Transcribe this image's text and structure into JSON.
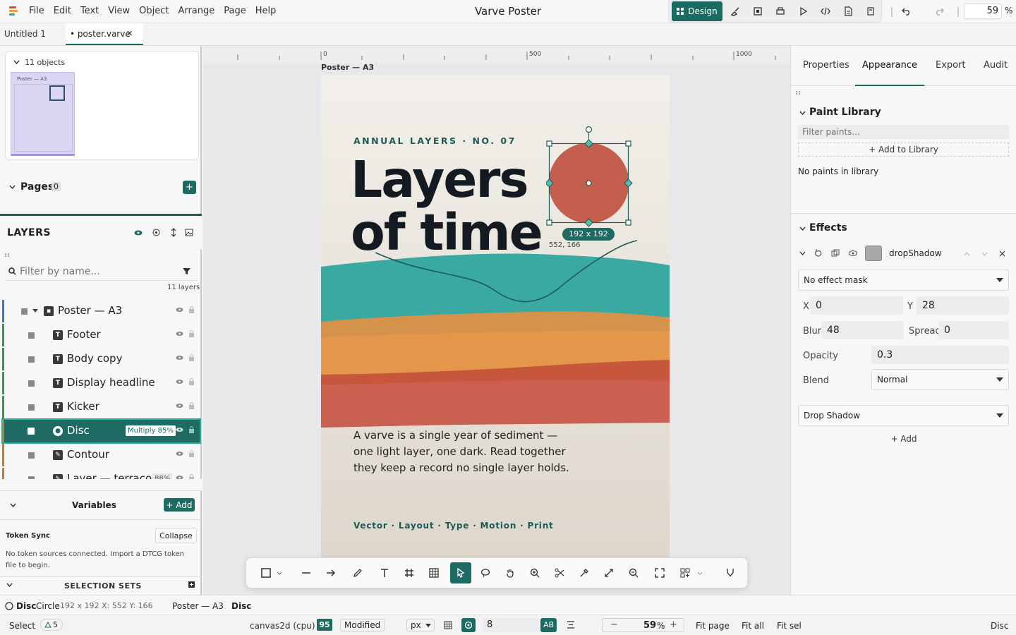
{
  "app": {
    "title": "Varve Poster",
    "menu": [
      "File",
      "Edit",
      "Text",
      "View",
      "Object",
      "Arrange",
      "Page",
      "Help"
    ],
    "design_label": "Design",
    "zoom": "59",
    "zoom_unit": "%"
  },
  "tabs": [
    {
      "label": "Untitled 1"
    },
    {
      "label": "• poster.varve",
      "close": "✕"
    }
  ],
  "overview": {
    "count": "11 objects",
    "thumb_label": "Poster — A3"
  },
  "pages": {
    "label": "Pages",
    "count": "0",
    "add": "+"
  },
  "layers": {
    "title": "LAYERS",
    "filter_placeholder": "Filter by name...",
    "count": "11 layers",
    "items": [
      {
        "name": "Poster — A3",
        "type": "frame",
        "color": "#3b73c9"
      },
      {
        "name": "Footer",
        "type": "text",
        "color": "#2c9a4a"
      },
      {
        "name": "Body copy",
        "type": "text",
        "color": "#2c9a4a"
      },
      {
        "name": "Display headline",
        "type": "text",
        "color": "#2c9a4a"
      },
      {
        "name": "Kicker",
        "type": "text",
        "color": "#2c9a4a"
      },
      {
        "name": "Disc",
        "type": "ellipse",
        "color": "#c67a2a",
        "badge": "Multiply 85%",
        "selected": true
      },
      {
        "name": "Contour",
        "type": "path",
        "color": "#c67a2a"
      },
      {
        "name": "Layer — terraco",
        "type": "path",
        "color": "#c67a2a",
        "badge": "88%"
      }
    ]
  },
  "variables": {
    "label": "Variables",
    "add": "+ Add"
  },
  "token_sync": {
    "label": "Token Sync",
    "button": "Collapse",
    "message": "No token sources connected. Import a DTCG token file to begin."
  },
  "selection_sets": {
    "label": "SELECTION SETS"
  },
  "ruler": {
    "marks": [
      "0",
      "500",
      "1000"
    ]
  },
  "poster": {
    "frame_label": "Poster — A3",
    "kicker": "ANNUAL LAYERS · NO. 07",
    "headline1": "Layers",
    "headline2": "of time",
    "body": "A varve is a single year of sediment — one light layer, one dark. Read together they keep a record no single layer holds.",
    "footer": "Vector · Layout · Type · Motion · Print",
    "disc_color": "#c45f4d",
    "size_label": "192 x 192",
    "pos_label": "552, 166"
  },
  "right": {
    "tabs": [
      "Properties",
      "Appearance",
      "Export",
      "Audit"
    ],
    "active_tab": "Appearance",
    "paint_library": {
      "title": "Paint Library",
      "filter_placeholder": "Filter paints...",
      "add": "+ Add to Library",
      "empty": "No paints in library"
    },
    "effects": {
      "title": "Effects",
      "effect_name": "dropShadow",
      "mask": "No effect mask",
      "x_label": "X",
      "x": "0",
      "y_label": "Y",
      "y": "28",
      "blur_label": "Blur",
      "blur": "48",
      "spread_label": "Spread",
      "spread": "0",
      "opacity_label": "Opacity",
      "opacity": "0.3",
      "blend_label": "Blend",
      "blend": "Normal",
      "type": "Drop Shadow",
      "add": "+ Add"
    }
  },
  "status1": {
    "name": "Disc",
    "kind": "Circle",
    "dims": "192 x 192 X: 552 Y: 166",
    "crumb1": "Poster — A3",
    "crumb2": "Disc"
  },
  "status2": {
    "mode": "Select",
    "warnings": "5",
    "renderer": "canvas2d (cpu)",
    "score": "95",
    "modified": "Modified",
    "unit": "px",
    "grid": "8",
    "ab": "AB",
    "zoom": "59",
    "zoom_unit": "%",
    "fit_page": "Fit page",
    "fit_all": "Fit all",
    "fit_sel": "Fit sel",
    "selection": "Disc"
  }
}
